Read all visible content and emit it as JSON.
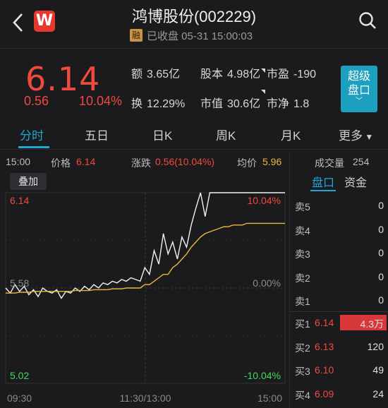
{
  "header": {
    "logo_letter": "W",
    "title": "鸿博股份(002229)",
    "badge": "融",
    "status": "已收盘 05-31 15:00:03"
  },
  "quote": {
    "price": "6.14",
    "change": "0.56",
    "change_pct": "10.04%",
    "amount_label": "额",
    "amount_value": "3.65亿",
    "capital_label": "股本",
    "capital_value": "4.98亿",
    "pe_label": "市盈",
    "pe_value": "-190",
    "turnover_label": "换",
    "turnover_value": "12.29%",
    "mktcap_label": "市值",
    "mktcap_value": "30.6亿",
    "pb_label": "市净",
    "pb_value": "1.8",
    "super_btn_line1": "超级",
    "super_btn_line2": "盘口"
  },
  "tabs": [
    {
      "label": "分时",
      "active": true
    },
    {
      "label": "五日",
      "active": false
    },
    {
      "label": "日K",
      "active": false
    },
    {
      "label": "周K",
      "active": false
    },
    {
      "label": "月K",
      "active": false
    },
    {
      "label": "更多",
      "active": false
    }
  ],
  "info_row": {
    "time": "15:00",
    "price_label": "价格",
    "price_value": "6.14",
    "chg_label": "涨跌",
    "chg_value": "0.56(10.04%)",
    "avg_label": "均价",
    "avg_value": "5.96",
    "vol_label": "成交量",
    "vol_value": "254"
  },
  "overlay_button": "叠加",
  "book": {
    "tab_active": "盘口",
    "tab_other": "资金",
    "asks": [
      {
        "label": "卖5",
        "price": "",
        "qty": "0"
      },
      {
        "label": "卖4",
        "price": "",
        "qty": "0"
      },
      {
        "label": "卖3",
        "price": "",
        "qty": "0"
      },
      {
        "label": "卖2",
        "price": "",
        "qty": "0"
      },
      {
        "label": "卖1",
        "price": "",
        "qty": "0"
      }
    ],
    "bids": [
      {
        "label": "买1",
        "price": "6.14",
        "qty": "4.3万",
        "bar": 1.0
      },
      {
        "label": "买2",
        "price": "6.13",
        "qty": "120",
        "bar": 0
      },
      {
        "label": "买3",
        "price": "6.10",
        "qty": "49",
        "bar": 0
      },
      {
        "label": "买4",
        "price": "6.09",
        "qty": "24",
        "bar": 0
      }
    ]
  },
  "colors": {
    "up": "#f04a3e",
    "down": "#3ddc5b",
    "accent": "#1fa6d3",
    "avg_line": "#e9b83c",
    "price_line": "#f2f2f2"
  },
  "chart_data": {
    "type": "line",
    "ylim": [
      5.02,
      6.14
    ],
    "y_ticks_left": [
      "6.14",
      "5.58",
      "5.02"
    ],
    "y_ticks_right": [
      "10.04%",
      "0.00%",
      "-10.04%"
    ],
    "x_ticks": [
      "09:30",
      "11:30/13:00",
      "15:00"
    ],
    "series": [
      {
        "values": [
          5.58,
          5.55,
          5.6,
          5.56,
          5.59,
          5.54,
          5.57,
          5.53,
          5.58,
          5.56,
          5.55,
          5.57,
          5.52,
          5.56,
          5.55,
          5.58,
          5.56,
          5.59,
          5.57,
          5.6,
          5.58,
          5.61,
          5.6,
          5.62,
          5.61,
          5.63,
          5.62,
          5.64,
          5.63,
          5.62,
          5.7,
          5.66,
          5.8,
          5.72,
          5.9,
          5.78,
          5.85,
          5.75,
          5.88,
          5.82,
          5.95,
          6.05,
          6.14,
          6.0,
          6.14,
          6.14,
          6.14,
          6.14,
          6.14,
          6.14,
          6.14,
          6.14,
          6.14,
          6.14,
          6.14,
          6.14,
          6.14,
          6.14,
          6.14,
          6.14
        ]
      },
      {
        "values": [
          5.55,
          5.55,
          5.55,
          5.555,
          5.555,
          5.555,
          5.56,
          5.56,
          5.56,
          5.56,
          5.56,
          5.56,
          5.56,
          5.56,
          5.56,
          5.565,
          5.565,
          5.565,
          5.565,
          5.57,
          5.57,
          5.57,
          5.57,
          5.575,
          5.575,
          5.575,
          5.58,
          5.58,
          5.58,
          5.58,
          5.6,
          5.6,
          5.62,
          5.64,
          5.66,
          5.66,
          5.7,
          5.72,
          5.75,
          5.78,
          5.82,
          5.85,
          5.88,
          5.9,
          5.91,
          5.92,
          5.93,
          5.94,
          5.94,
          5.95,
          5.95,
          5.95,
          5.96,
          5.96,
          5.96,
          5.96,
          5.96,
          5.96,
          5.96,
          5.96
        ]
      }
    ]
  }
}
